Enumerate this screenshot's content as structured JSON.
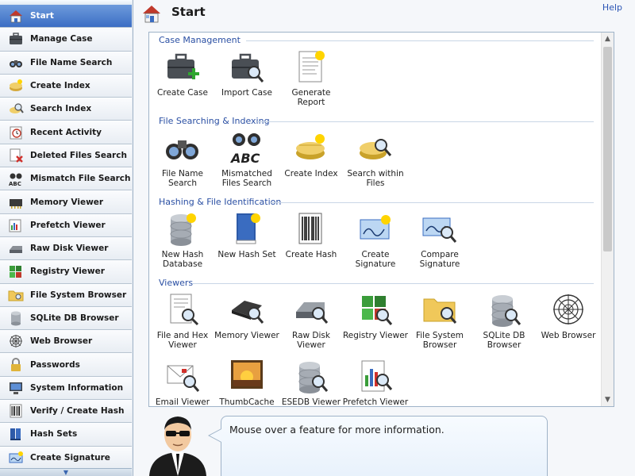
{
  "sidebar": {
    "items": [
      {
        "label": "Start",
        "icon": "home-icon",
        "active": true
      },
      {
        "label": "Manage Case",
        "icon": "briefcase-icon"
      },
      {
        "label": "File Name Search",
        "icon": "binoculars-icon"
      },
      {
        "label": "Create Index",
        "icon": "index-icon"
      },
      {
        "label": "Search Index",
        "icon": "search-index-icon"
      },
      {
        "label": "Recent Activity",
        "icon": "clock-icon"
      },
      {
        "label": "Deleted Files Search",
        "icon": "deleted-file-icon"
      },
      {
        "label": "Mismatch File Search",
        "icon": "abc-binoculars-icon"
      },
      {
        "label": "Memory Viewer",
        "icon": "memory-chip-icon"
      },
      {
        "label": "Prefetch Viewer",
        "icon": "prefetch-icon"
      },
      {
        "label": "Raw Disk Viewer",
        "icon": "disk-icon"
      },
      {
        "label": "Registry Viewer",
        "icon": "registry-icon"
      },
      {
        "label": "File System Browser",
        "icon": "folder-icon"
      },
      {
        "label": "SQLite DB Browser",
        "icon": "database-icon"
      },
      {
        "label": "Web Browser",
        "icon": "web-icon"
      },
      {
        "label": "Passwords",
        "icon": "lock-icon"
      },
      {
        "label": "System Information",
        "icon": "computer-icon"
      },
      {
        "label": "Verify / Create Hash",
        "icon": "barcode-icon"
      },
      {
        "label": "Hash Sets",
        "icon": "books-icon"
      },
      {
        "label": "Create Signature",
        "icon": "signature-icon"
      }
    ]
  },
  "header": {
    "title": "Start",
    "help": "Help"
  },
  "sections": [
    {
      "title": "Case Management",
      "features": [
        "Create Case",
        "Import Case",
        "Generate Report"
      ]
    },
    {
      "title": "File Searching & Indexing",
      "features": [
        "File Name Search",
        "Mismatched Files Search",
        "Create Index",
        "Search within Files"
      ]
    },
    {
      "title": "Hashing & File Identification",
      "features": [
        "New Hash Database",
        "New Hash Set",
        "Create Hash",
        "Create Signature",
        "Compare Signature"
      ]
    },
    {
      "title": "Viewers",
      "features": [
        "File and Hex Viewer",
        "Memory Viewer",
        "Raw Disk Viewer",
        "Registry Viewer",
        "File System Browser",
        "SQLite DB Browser",
        "Web Browser",
        "Email Viewer",
        "ThumbCache Viewer",
        "ESEDB Viewer",
        "Prefetch Viewer"
      ]
    }
  ],
  "info": {
    "message": "Mouse over a feature for more information."
  },
  "colors": {
    "accent": "#3c6ec4",
    "section_title": "#2a4fa3",
    "link": "#2b55b5"
  }
}
